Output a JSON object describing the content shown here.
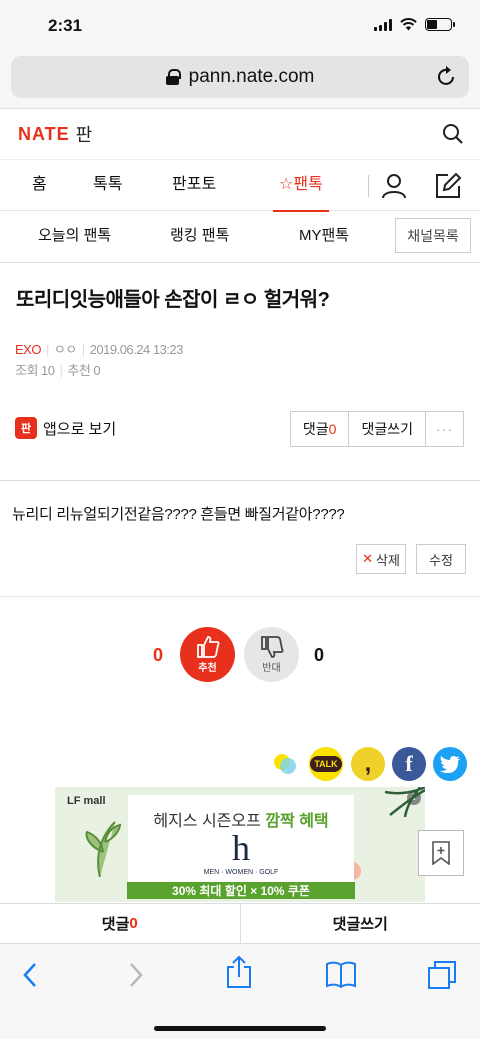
{
  "status": {
    "time": "2:31"
  },
  "browser": {
    "url": "pann.nate.com"
  },
  "site": {
    "logo": "NATE",
    "section": "판"
  },
  "main_nav": [
    {
      "label": "홈"
    },
    {
      "label": "톡톡"
    },
    {
      "label": "판포토"
    },
    {
      "label": "☆팬톡",
      "active": true
    }
  ],
  "sub_nav": {
    "items": [
      {
        "label": "오늘의 팬톡"
      },
      {
        "label": "랭킹 팬톡"
      },
      {
        "label": "MY팬톡"
      }
    ],
    "channel_button": "채널목록"
  },
  "post": {
    "title": "또리디잇능애들아 손잡이 ㄹㅇ 헐거워?",
    "channel": "EXO",
    "author": "ㅇㅇ",
    "date": "2019.06.24 13:23",
    "views": "조회 10",
    "recommends": "추천 0",
    "app_badge": "판",
    "app_view": "앱으로 보기",
    "comment_label": "댓글",
    "comment_count": "0",
    "write_comment": "댓글쓰기",
    "more": "···",
    "body": "뉴리디 리뉴얼되기전같음???? 흔들면 빠질거같아????",
    "delete_label": "삭제",
    "edit_label": "수정"
  },
  "votes": {
    "up_count": "0",
    "up_label": "추천",
    "down_count": "0",
    "down_label": "반대"
  },
  "share": {
    "kakaotalk_label": "TALK"
  },
  "ad": {
    "brand": "LF mall",
    "headline_a": "헤지스 시즌오프",
    "headline_b": "깜짝 혜택",
    "brand_logo": "h",
    "tagline": "MEN · WOMEN · GOLF",
    "offer": "30% 최대 할인 × 10% 쿠폰",
    "info_icon": "!"
  },
  "bottom_bar": {
    "comment_label": "댓글",
    "comment_count": "0",
    "write_comment": "댓글쓰기"
  },
  "colors": {
    "brand_red": "#e8311c",
    "kakao_yellow": "#fae100",
    "facebook": "#3b5998",
    "twitter": "#1da1f2",
    "ad_green": "#5aa22e"
  }
}
